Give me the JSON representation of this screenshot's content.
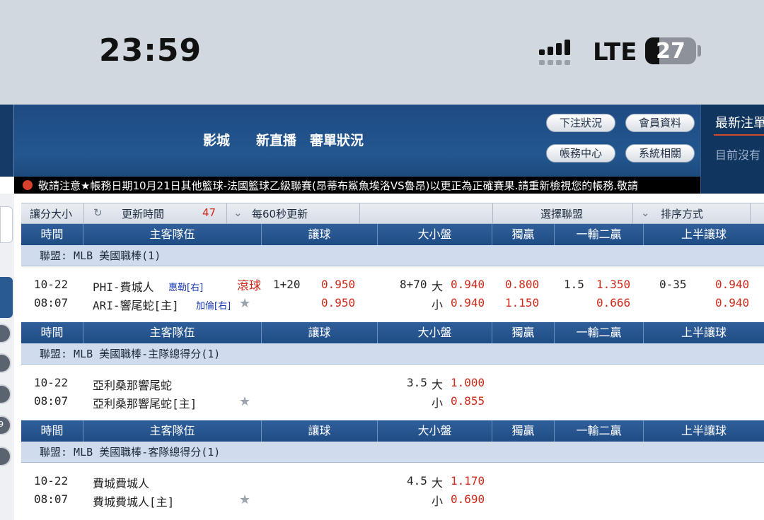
{
  "status_bar": {
    "time": "23:59",
    "network": "LTE",
    "battery": "27"
  },
  "header": {
    "nav": [
      "影城",
      "新直播",
      "審單狀況"
    ],
    "buttons": [
      "下注狀況",
      "會員資料",
      "帳務中心",
      "系統相關"
    ]
  },
  "side_panel": {
    "title": "最新注單",
    "subtitle": "目前沒有"
  },
  "marquee": "敬請注意★帳務日期10月21日其他籃球-法國籃球乙級聯賽(昂蒂布鯊魚埃洛VS魯昂)以更正為正確賽果.請重新檢視您的帳務.敬請",
  "sidebar": {
    "badge": "9"
  },
  "toolbar": {
    "size": "讓分大小",
    "refresh": "更新時間",
    "countdown": "47",
    "interval": "每60秒更新",
    "league_select": "選擇聯盟",
    "sort": "排序方式"
  },
  "columns": [
    "時間",
    "主客隊伍",
    "讓球",
    "大小盤",
    "獨贏",
    "一輸二贏",
    "上半讓球"
  ],
  "sections": [
    {
      "league": "聯盟: MLB 美國職棒(1)",
      "date": "10-22",
      "time": "08:07",
      "home": "PHI-費城人",
      "home_pitcher": "惠勒[右]",
      "away": "ARI-響尾蛇[主]",
      "away_pitcher": "加倫[右]",
      "live": "滾球",
      "handicap": "1+20",
      "hc_odds1": "0.950",
      "hc_odds2": "0.950",
      "ou_line": "8+70",
      "ou_over": "大",
      "ou_over_odds": "0.940",
      "ou_under": "小",
      "ou_under_odds": "0.940",
      "ml1": "0.800",
      "ml2": "1.150",
      "otw_line": "1.5",
      "otw1": "1.350",
      "otw2": "0.666",
      "h1_line": "0-35",
      "h1_odds1": "0.940",
      "h1_odds2": "0.940"
    },
    {
      "league": "聯盟: MLB 美國職棒-主隊總得分(1)",
      "date": "10-22",
      "time": "08:07",
      "home": "亞利桑那響尾蛇",
      "away": "亞利桑那響尾蛇[主]",
      "ou_line": "3.5",
      "ou_over": "大",
      "ou_over_odds": "1.000",
      "ou_under": "小",
      "ou_under_odds": "0.855"
    },
    {
      "league": "聯盟: MLB 美國職棒-客隊總得分(1)",
      "date": "10-22",
      "time": "08:07",
      "home": "費城費城人",
      "away": "費城費城人[主]",
      "ou_line": "4.5",
      "ou_over": "大",
      "ou_over_odds": "1.170",
      "ou_under": "小",
      "ou_under_odds": "0.690"
    }
  ]
}
